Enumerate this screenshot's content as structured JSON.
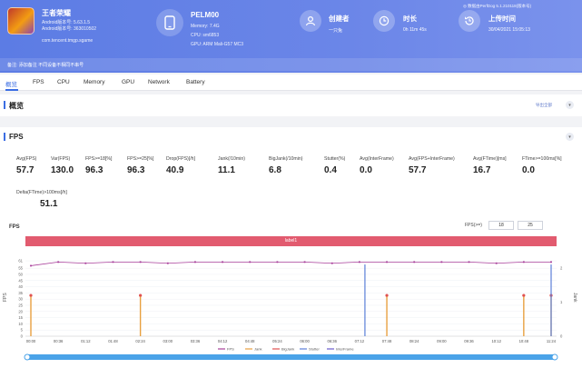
{
  "header": {
    "app": {
      "name": "王者荣耀",
      "android_version": "Android版本号: 5.63.1.5",
      "android_code": "Android版本号: 363010502",
      "package": "com.tencent.tmgp.sgame"
    },
    "device": {
      "name": "PELM00",
      "memory": "Memory: 7.4G",
      "cpu": "CPU: sm6853",
      "gpu": "GPU: ARM Mali-G57 MC3"
    },
    "stats": [
      {
        "label": "创建者",
        "value": "一只兔",
        "icon": "user-icon"
      },
      {
        "label": "时长",
        "value": "0h 11m 45s",
        "icon": "clock-icon"
      },
      {
        "label": "上传时间",
        "value": "30/04/2021 15:05:13",
        "icon": "history-icon"
      }
    ],
    "top_tools": "◎ 数据由PerfDog 5.1.210118(版本号)",
    "note": "备注:  添加备注     不同设备不相同不串号"
  },
  "tabs": [
    "概览",
    "FPS",
    "CPU",
    "Memory",
    "GPU",
    "Network",
    "Battery"
  ],
  "overview": {
    "title": "概览",
    "export_label": "导出全部"
  },
  "fps_section": {
    "title": "FPS",
    "metrics": [
      {
        "label": "Avg(FPS)",
        "value": "57.7"
      },
      {
        "label": "Var(FPS)",
        "value": "130.0"
      },
      {
        "label": "FPS>=18[%]",
        "value": "96.3"
      },
      {
        "label": "FPS>=25[%]",
        "value": "96.3"
      },
      {
        "label": "Drop(FPS)[/h]",
        "value": "40.9"
      },
      {
        "label": "Jank(/10min)",
        "value": "11.1"
      },
      {
        "label": "BigJank(/10min)",
        "value": "6.8"
      },
      {
        "label": "Stutter(%)",
        "value": "0.4"
      },
      {
        "label": "Avg(InterFrame)",
        "value": "0.0"
      },
      {
        "label": "Avg(FPS+InterFrame)",
        "value": "57.7"
      },
      {
        "label": "Avg(FTime)[ms]",
        "value": "16.7"
      },
      {
        "label": "FTime>=100ms[%]",
        "value": "0.0"
      },
      {
        "label": "Delta(FTime)>100ms[/h]",
        "value": "51.1"
      }
    ]
  },
  "chart": {
    "title": "FPS",
    "filter_label": "FPS(>=)",
    "filter_values": [
      "18",
      "25"
    ],
    "scene_label": "label1",
    "y_axis_label": "FPS",
    "y2_axis_label": "Jank",
    "legend": [
      "FPS",
      "Jank",
      "BigJank",
      "Stutter",
      "InterFrame"
    ],
    "colors": {
      "fps": "#a83e9a",
      "jank": "#e8a040",
      "bigjank": "#e05050",
      "stutter": "#5b7fd8",
      "interframe": "#6a5acd",
      "accent": "#3b6de3",
      "scene": "#e25b6f"
    }
  },
  "chart_data": {
    "type": "line",
    "ylim": [
      0,
      61
    ],
    "y_ticks": [
      "61",
      "55",
      "50",
      "45",
      "40",
      "35",
      "30",
      "25",
      "20",
      "15",
      "10",
      "5",
      "0"
    ],
    "y2_ticks": [
      "2",
      "1",
      "0"
    ],
    "x_ticks": [
      "00:00",
      "00:36",
      "01:12",
      "01:48",
      "02:24",
      "03:00",
      "03:36",
      "04:12",
      "04:48",
      "05:24",
      "06:00",
      "06:36",
      "07:12",
      "07:48",
      "08:24",
      "09:00",
      "09:36",
      "10:12",
      "10:48",
      "11:24"
    ],
    "series": [
      {
        "name": "FPS",
        "values": [
          57,
          60,
          59,
          60,
          60,
          59,
          60,
          60,
          60,
          60,
          60,
          59,
          60,
          60,
          60,
          60,
          60,
          59,
          60,
          60
        ]
      },
      {
        "name": "Jank",
        "values": [
          1,
          0,
          0,
          0,
          1,
          0,
          0,
          0,
          0,
          0,
          0,
          0,
          0,
          1,
          0,
          0,
          0,
          0,
          1,
          2
        ]
      }
    ]
  }
}
